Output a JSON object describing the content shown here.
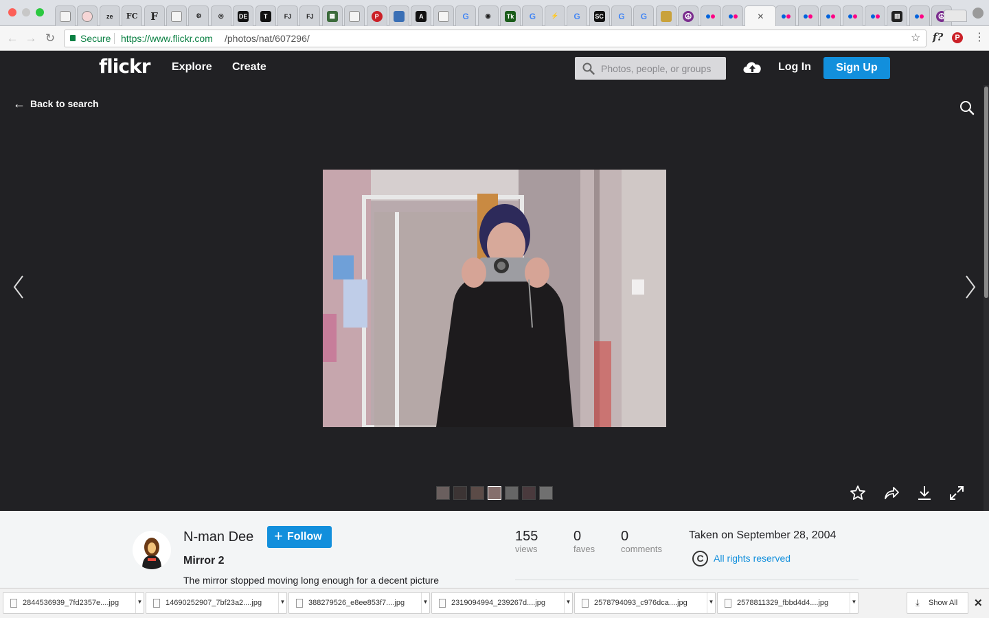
{
  "browser": {
    "url_secure_label": "Secure",
    "url_prefix": "https://www.flickr.com",
    "url_path": "/photos/nat/607296/",
    "tabs": [
      {
        "icon": "doc-icon",
        "glyph": ""
      },
      {
        "icon": "circle-icon",
        "glyph": ""
      },
      {
        "icon": "zeen-icon",
        "glyph": "ze"
      },
      {
        "icon": "fc-icon",
        "glyph": "FC"
      },
      {
        "icon": "f-icon",
        "glyph": "F"
      },
      {
        "icon": "figure-icon",
        "glyph": ""
      },
      {
        "icon": "gear-icon",
        "glyph": "⚙"
      },
      {
        "icon": "ring-icon",
        "glyph": "◎"
      },
      {
        "icon": "de-icon",
        "glyph": "DE"
      },
      {
        "icon": "t-icon",
        "glyph": "T"
      },
      {
        "icon": "fj-icon",
        "glyph": "FJ"
      },
      {
        "icon": "fj-icon",
        "glyph": "FJ"
      },
      {
        "icon": "grid-icon",
        "glyph": "▦"
      },
      {
        "icon": "doc-icon",
        "glyph": ""
      },
      {
        "icon": "pinterest-icon",
        "glyph": "P"
      },
      {
        "icon": "book-icon",
        "glyph": ""
      },
      {
        "icon": "a-icon",
        "glyph": "A"
      },
      {
        "icon": "doc-icon",
        "glyph": ""
      },
      {
        "icon": "google-icon",
        "glyph": "G"
      },
      {
        "icon": "eye-icon",
        "glyph": "◉"
      },
      {
        "icon": "tk-icon",
        "glyph": "Tk"
      },
      {
        "icon": "google-icon",
        "glyph": "G"
      },
      {
        "icon": "bolt-icon",
        "glyph": "⚡"
      },
      {
        "icon": "google-icon",
        "glyph": "G"
      },
      {
        "icon": "sc-icon",
        "glyph": "SC"
      },
      {
        "icon": "google-icon",
        "glyph": "G"
      },
      {
        "icon": "google-icon",
        "glyph": "G"
      },
      {
        "icon": "tv-icon",
        "glyph": ""
      },
      {
        "icon": "peace-icon",
        "glyph": "☮"
      },
      {
        "icon": "flickr-icon",
        "glyph": ""
      },
      {
        "icon": "flickr-icon",
        "glyph": ""
      },
      {
        "icon": "close-icon",
        "glyph": "✕",
        "active": true
      },
      {
        "icon": "flickr-icon",
        "glyph": ""
      },
      {
        "icon": "flickr-icon",
        "glyph": ""
      },
      {
        "icon": "flickr-icon",
        "glyph": ""
      },
      {
        "icon": "flickr-icon",
        "glyph": ""
      },
      {
        "icon": "flickr-icon",
        "glyph": ""
      },
      {
        "icon": "museum-icon",
        "glyph": "▥"
      },
      {
        "icon": "flickr-icon",
        "glyph": ""
      },
      {
        "icon": "peace-icon",
        "glyph": "☮"
      }
    ]
  },
  "flickr": {
    "logo": "flickr",
    "nav": {
      "explore": "Explore",
      "create": "Create"
    },
    "search_placeholder": "Photos, people, or groups",
    "login": "Log In",
    "signup": "Sign Up",
    "back_label": "Back to search"
  },
  "photo": {
    "owner": "N-man Dee",
    "follow_label": "Follow",
    "title": "Mirror 2",
    "description": "The mirror stopped moving long enough for a decent picture",
    "stats": [
      {
        "value": "155",
        "label": "views"
      },
      {
        "value": "0",
        "label": "faves"
      },
      {
        "value": "0",
        "label": "comments"
      }
    ],
    "taken": "Taken on September 28, 2004",
    "license": "All rights reserved"
  },
  "downloads": {
    "items": [
      "2844536939_7fd2357e....jpg",
      "14690252907_7bf23a2....jpg",
      "388279526_e8ee853f7....jpg",
      "2319094994_239267d....jpg",
      "2578794093_c976dca....jpg",
      "2578811329_fbbd4d4....jpg"
    ],
    "show_all": "Show All"
  },
  "colors": {
    "flickr_blue": "#128fdc",
    "header_bg": "#212124",
    "flickr_pink": "#ff0084",
    "flickr_blue_dot": "#0063dc"
  }
}
